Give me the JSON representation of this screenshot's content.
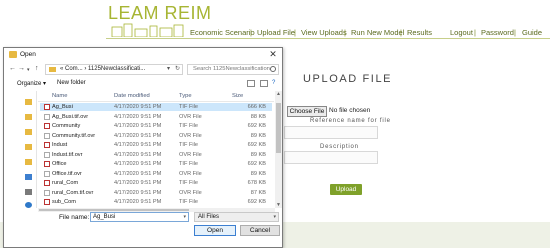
{
  "brand": {
    "name": "LEAM REIM"
  },
  "nav": {
    "items": [
      "Economic Scenario",
      "Upload File",
      "View Uploads",
      "Run New Model",
      "Results"
    ],
    "right_items": [
      "Logout",
      "Password",
      "Guide"
    ],
    "separator": "|"
  },
  "upload_form": {
    "title": "UPLOAD FILE",
    "choose_button": "Choose File",
    "no_file_text": "No file chosen",
    "reference_label": "Reference name for file",
    "description_label": "Description",
    "upload_button": "Upload"
  },
  "dialog": {
    "title": "Open",
    "path": "« Com... › 1125Newclassificati...",
    "search_placeholder": "Search 1125Newclassification",
    "toolbar": {
      "organize": "Organize ▾",
      "new_folder": "New folder"
    },
    "columns": {
      "name": "Name",
      "date": "Date modified",
      "type": "Type",
      "size": "Size"
    },
    "files": [
      {
        "name": "Ag_Busi",
        "date": "4/17/2020 9:51 PM",
        "type": "TIF File",
        "size": "666 KB",
        "kind": "tif",
        "selected": true
      },
      {
        "name": "Ag_Busi.tif.ovr",
        "date": "4/17/2020 9:51 PM",
        "type": "OVR File",
        "size": "88 KB",
        "kind": "ovr",
        "selected": false
      },
      {
        "name": "Community",
        "date": "4/17/2020 9:51 PM",
        "type": "TIF File",
        "size": "692 KB",
        "kind": "tif",
        "selected": false
      },
      {
        "name": "Community.tif.ovr",
        "date": "4/17/2020 9:51 PM",
        "type": "OVR File",
        "size": "89 KB",
        "kind": "ovr",
        "selected": false
      },
      {
        "name": "Indust",
        "date": "4/17/2020 9:51 PM",
        "type": "TIF File",
        "size": "692 KB",
        "kind": "tif",
        "selected": false
      },
      {
        "name": "Indust.tif.ovr",
        "date": "4/17/2020 9:51 PM",
        "type": "OVR File",
        "size": "89 KB",
        "kind": "ovr",
        "selected": false
      },
      {
        "name": "Office",
        "date": "4/17/2020 9:51 PM",
        "type": "TIF File",
        "size": "692 KB",
        "kind": "tif",
        "selected": false
      },
      {
        "name": "Office.tif.ovr",
        "date": "4/17/2020 9:51 PM",
        "type": "OVR File",
        "size": "89 KB",
        "kind": "ovr",
        "selected": false
      },
      {
        "name": "rural_Com",
        "date": "4/17/2020 9:51 PM",
        "type": "TIF File",
        "size": "678 KB",
        "kind": "tif",
        "selected": false
      },
      {
        "name": "rural_Com.tif.ovr",
        "date": "4/17/2020 9:51 PM",
        "type": "OVR File",
        "size": "87 KB",
        "kind": "ovr",
        "selected": false
      },
      {
        "name": "sub_Com",
        "date": "4/17/2020 9:51 PM",
        "type": "TIF File",
        "size": "692 KB",
        "kind": "tif",
        "selected": false
      }
    ],
    "filename_label": "File name:",
    "filename_value": "Ag_Busi",
    "filetype_value": "All Files",
    "open_button": "Open",
    "cancel_button": "Cancel"
  },
  "colors": {
    "brand": "#a7b533",
    "nav_text": "#5a6a1e",
    "upload_button": "#7fa12a",
    "selection": "#cce6fb"
  }
}
